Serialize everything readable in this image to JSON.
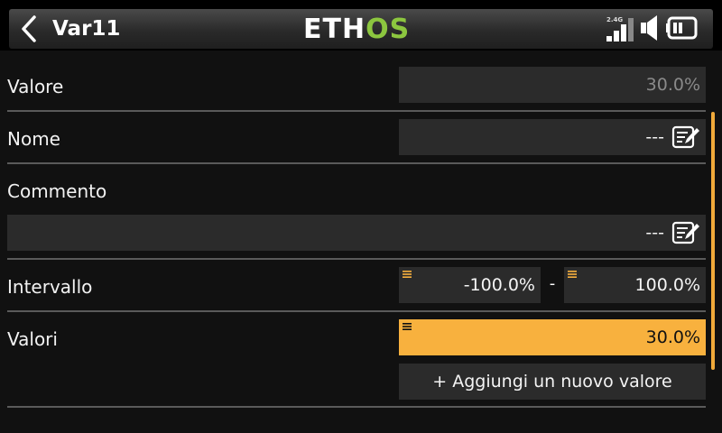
{
  "header": {
    "title": "Var11",
    "logo_eth": "ETH",
    "logo_os": "OS",
    "signal_label": "2.4G",
    "accent": "#8cc63f"
  },
  "fields": {
    "valore": {
      "label": "Valore",
      "value": "30.0%"
    },
    "nome": {
      "label": "Nome",
      "value": "---"
    },
    "commento": {
      "label": "Commento",
      "value": "---"
    },
    "intervallo": {
      "label": "Intervallo",
      "min": "-100.0%",
      "separator": "-",
      "max": "100.0%"
    },
    "valori": {
      "label": "Valori",
      "value": "30.0%",
      "highlight": "#f8b13e"
    }
  },
  "add_button": {
    "label": "+ Aggiungi un nuovo valore"
  }
}
